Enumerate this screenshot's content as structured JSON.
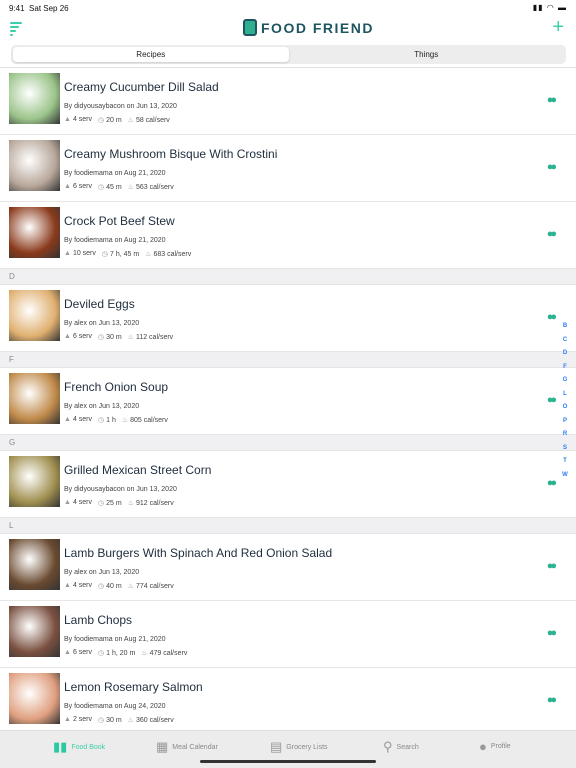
{
  "status": {
    "time": "9:41",
    "date": "Sat Sep 26"
  },
  "header": {
    "title": "FOOD FRIEND",
    "add": "+"
  },
  "segments": [
    "Recipes",
    "Things"
  ],
  "sections": [
    {
      "letter": "",
      "recipes": [
        {
          "title": "Creamy Cucumber Dill Salad",
          "by": "By didyousaybacon on Jun 13, 2020",
          "serv": "4 serv",
          "time": "20 m",
          "cal": "58 cal/serv",
          "color": "#9bc48a"
        },
        {
          "title": "Creamy Mushroom Bisque With Crostini",
          "by": "By foodiemama on Aug 21, 2020",
          "serv": "6 serv",
          "time": "45 m",
          "cal": "563 cal/serv",
          "color": "#b8a79a"
        },
        {
          "title": "Crock Pot Beef Stew",
          "by": "By foodiemama on Aug 21, 2020",
          "serv": "10 serv",
          "time": "7 h, 45 m",
          "cal": "683 cal/serv",
          "color": "#8a3a1c"
        }
      ]
    },
    {
      "letter": "D",
      "recipes": [
        {
          "title": "Deviled Eggs",
          "by": "By alex on Jun 13, 2020",
          "serv": "6 serv",
          "time": "30 m",
          "cal": "112 cal/serv",
          "color": "#e0b070"
        }
      ]
    },
    {
      "letter": "F",
      "recipes": [
        {
          "title": "French Onion Soup",
          "by": "By alex on Jun 13, 2020",
          "serv": "4 serv",
          "time": "1 h",
          "cal": "805 cal/serv",
          "color": "#c08a4a"
        }
      ]
    },
    {
      "letter": "G",
      "recipes": [
        {
          "title": "Grilled Mexican Street Corn",
          "by": "By didyousaybacon on Jun 13, 2020",
          "serv": "4 serv",
          "time": "25 m",
          "cal": "912 cal/serv",
          "color": "#a09050"
        }
      ]
    },
    {
      "letter": "L",
      "recipes": [
        {
          "title": "Lamb Burgers With Spinach And Red Onion Salad",
          "by": "By alex on Jun 13, 2020",
          "serv": "4 serv",
          "time": "40 m",
          "cal": "774 cal/serv",
          "color": "#6a4a30"
        },
        {
          "title": "Lamb Chops",
          "by": "By foodiemama on Aug 21, 2020",
          "serv": "6 serv",
          "time": "1 h, 20 m",
          "cal": "479 cal/serv",
          "color": "#7a5040"
        },
        {
          "title": "Lemon Rosemary Salmon",
          "by": "By foodiemama on Aug 24, 2020",
          "serv": "2 serv",
          "time": "30 m",
          "cal": "360 cal/serv",
          "color": "#e0a080"
        }
      ]
    }
  ],
  "index": [
    "B",
    "C",
    "D",
    "F",
    "G",
    "L",
    "O",
    "P",
    "R",
    "S",
    "T",
    "W"
  ],
  "tabs": [
    {
      "label": "Food Book",
      "icon": "book-icon",
      "active": true
    },
    {
      "label": "Meal Calendar",
      "icon": "calendar-icon"
    },
    {
      "label": "Grocery Lists",
      "icon": "clipboard-icon"
    },
    {
      "label": "Search",
      "icon": "search-icon"
    },
    {
      "label": "Profile",
      "icon": "person-icon"
    }
  ],
  "colors": {
    "accent": "#3ccfa9",
    "index": "#2a7ef5"
  }
}
